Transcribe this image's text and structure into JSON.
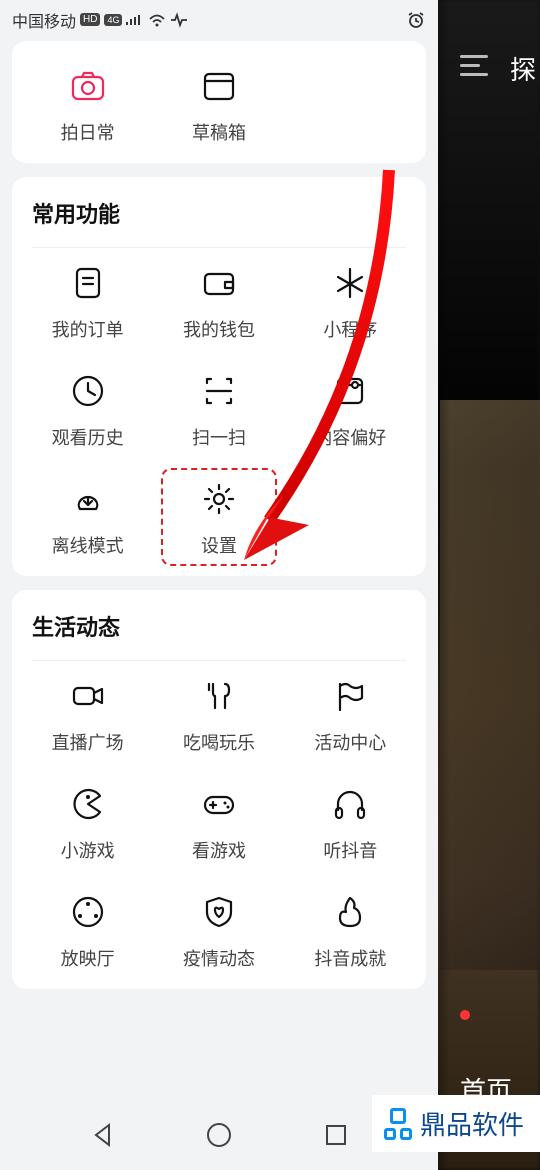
{
  "status": {
    "carrier": "中国移动",
    "hd": "HD",
    "net": "4G"
  },
  "background": {
    "tab": "探",
    "home": "首页"
  },
  "watermark": "鼎品软件",
  "top_card": {
    "items": [
      {
        "id": "daily",
        "label": "拍日常",
        "icon": "camera-icon",
        "red": true
      },
      {
        "id": "drafts",
        "label": "草稿箱",
        "icon": "drafts-icon"
      }
    ]
  },
  "section_common": {
    "title": "常用功能",
    "items": [
      {
        "id": "orders",
        "label": "我的订单",
        "icon": "orders-icon"
      },
      {
        "id": "wallet",
        "label": "我的钱包",
        "icon": "wallet-icon"
      },
      {
        "id": "miniapp",
        "label": "小程序",
        "icon": "miniapp-icon"
      },
      {
        "id": "history",
        "label": "观看历史",
        "icon": "history-icon"
      },
      {
        "id": "scan",
        "label": "扫一扫",
        "icon": "scan-icon"
      },
      {
        "id": "pref",
        "label": "内容偏好",
        "icon": "pref-icon"
      },
      {
        "id": "offline",
        "label": "离线模式",
        "icon": "offline-icon"
      },
      {
        "id": "settings",
        "label": "设置",
        "icon": "gear-icon",
        "highlighted": true
      }
    ]
  },
  "section_life": {
    "title": "生活动态",
    "items": [
      {
        "id": "live",
        "label": "直播广场",
        "icon": "livecam-icon"
      },
      {
        "id": "food",
        "label": "吃喝玩乐",
        "icon": "fork-icon"
      },
      {
        "id": "activity",
        "label": "活动中心",
        "icon": "flag-icon"
      },
      {
        "id": "games",
        "label": "小游戏",
        "icon": "pacman-icon"
      },
      {
        "id": "watchgame",
        "label": "看游戏",
        "icon": "gamepad-icon"
      },
      {
        "id": "listen",
        "label": "听抖音",
        "icon": "headphones-icon"
      },
      {
        "id": "cinema",
        "label": "放映厅",
        "icon": "film-icon"
      },
      {
        "id": "covid",
        "label": "疫情动态",
        "icon": "shield-heart-icon"
      },
      {
        "id": "achieve",
        "label": "抖音成就",
        "icon": "fire-icon"
      }
    ]
  }
}
